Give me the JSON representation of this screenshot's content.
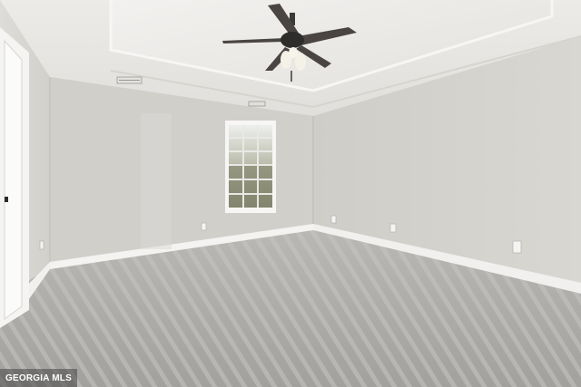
{
  "photo": {
    "subject": "empty-bedroom",
    "fixtures": [
      "ceiling-fan",
      "window",
      "door",
      "air-vent",
      "electrical-outlet"
    ],
    "colors": {
      "ceiling": "#e6e4e1",
      "left_wall": "#d7d5d0",
      "back_wall": "#cfcdc7",
      "right_wall": "#d3d1cb",
      "carpet": "#a9a7a4",
      "trim": "#f4f3f1",
      "fan_dark": "#3c3a38"
    }
  },
  "watermark": {
    "text": "GEORGIA MLS"
  }
}
